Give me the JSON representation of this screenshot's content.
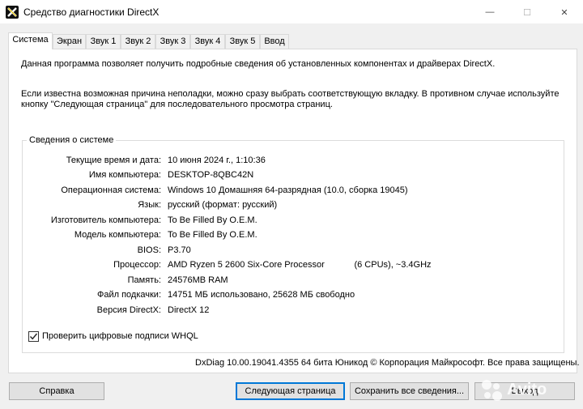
{
  "window": {
    "title": "Средство диагностики DirectX",
    "minimize_glyph": "—",
    "maximize_glyph": "☐",
    "close_glyph": "✕"
  },
  "tabs": [
    {
      "label": "Система",
      "active": true
    },
    {
      "label": "Экран",
      "active": false
    },
    {
      "label": "Звук 1",
      "active": false
    },
    {
      "label": "Звук 2",
      "active": false
    },
    {
      "label": "Звук 3",
      "active": false
    },
    {
      "label": "Звук 4",
      "active": false
    },
    {
      "label": "Звук 5",
      "active": false
    },
    {
      "label": "Ввод",
      "active": false
    }
  ],
  "intro": {
    "line1": "Данная программа позволяет получить подробные сведения об установленных компонентах и драйверах DirectX.",
    "line2": "Если известна возможная причина неполадки, можно сразу выбрать соответствующую вкладку. В противном случае используйте кнопку \"Следующая страница\" для последовательного просмотра страниц."
  },
  "system_info": {
    "legend": "Сведения о системе",
    "rows": [
      {
        "label": "Текущие время и дата:",
        "value": "10 июня 2024 г., 1:10:36"
      },
      {
        "label": "Имя компьютера:",
        "value": "DESKTOP-8QBC42N"
      },
      {
        "label": "Операционная система:",
        "value": "Windows 10 Домашняя 64-разрядная (10.0, сборка 19045)"
      },
      {
        "label": "Язык:",
        "value": "русский (формат: русский)"
      },
      {
        "label": "Изготовитель компьютера:",
        "value": "To Be Filled By O.E.M."
      },
      {
        "label": "Модель компьютера:",
        "value": "To Be Filled By O.E.M."
      },
      {
        "label": "BIOS:",
        "value": "P3.70"
      },
      {
        "label": "Процессор:",
        "value": "AMD Ryzen 5 2600 Six-Core Processor            (6 CPUs), ~3.4GHz"
      },
      {
        "label": "Память:",
        "value": "24576MB RAM"
      },
      {
        "label": "Файл подкачки:",
        "value": "14751 МБ использовано, 25628 МБ свободно"
      },
      {
        "label": "Версия DirectX:",
        "value": "DirectX 12"
      }
    ]
  },
  "whql": {
    "label": "Проверить цифровые подписи WHQL",
    "checked": true
  },
  "footer": "DxDiag 10.00.19041.4355 64 бита Юникод © Корпорация Майкрософт. Все права защищены.",
  "buttons": {
    "help": "Справка",
    "next": "Следующая страница",
    "save": "Сохранить все сведения...",
    "exit": "Выход"
  },
  "watermark": "Avito",
  "colors": {
    "accent": "#0078d7"
  }
}
